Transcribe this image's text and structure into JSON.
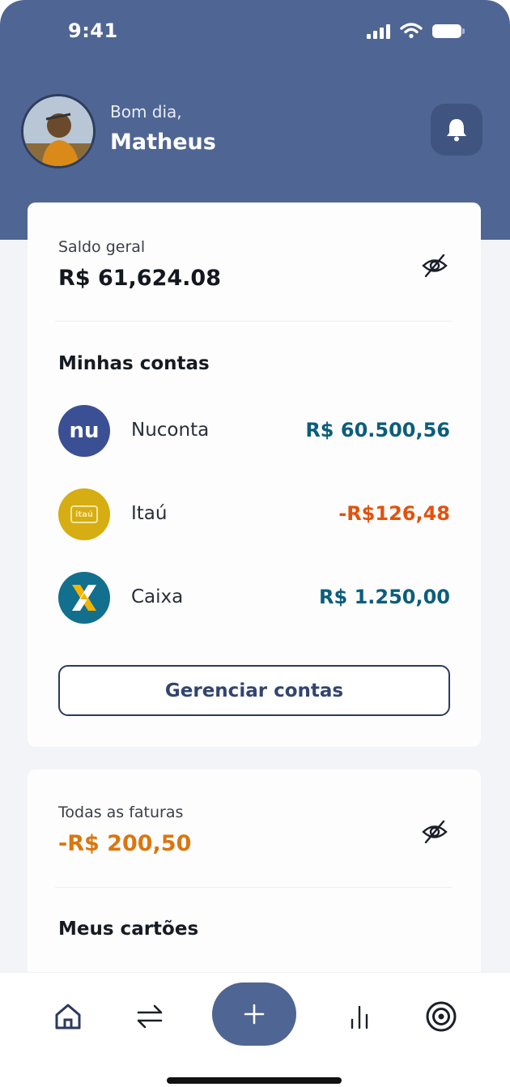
{
  "status_bar": {
    "time": "9:41"
  },
  "profile": {
    "greeting": "Bom dia,",
    "name": "Matheus"
  },
  "overview": {
    "label": "Saldo geral",
    "amount": "R$ 61,624.08"
  },
  "accounts": {
    "title": "Minhas contas",
    "items": [
      {
        "name": "Nuconta",
        "balance": "R$ 60.500,56",
        "balance_color": "#0c5d7c",
        "logo_text": "nu",
        "logo_color": "#3a4f94"
      },
      {
        "name": "Itaú",
        "balance": "-R$126,48",
        "balance_color": "#e2520e",
        "logo_text": "itaú",
        "logo_color": "#d6ad12"
      },
      {
        "name": "Caixa",
        "balance": "R$ 1.250,00",
        "balance_color": "#0c5d7c",
        "logo_text": "",
        "logo_color": "#136f8e"
      }
    ],
    "manage_label": "Gerenciar contas"
  },
  "invoices": {
    "label": "Todas as faturas",
    "amount": "-R$ 200,50",
    "amount_color": "#d9770f"
  },
  "cards": {
    "title": "Meus cartões"
  },
  "nav": {
    "items": [
      "home-icon",
      "transfer-icon",
      "add-icon",
      "chart-icon",
      "target-icon"
    ],
    "fab_symbol": "+"
  },
  "colors": {
    "header": "#4f6593",
    "accent_dark": "#2c3a5e"
  }
}
